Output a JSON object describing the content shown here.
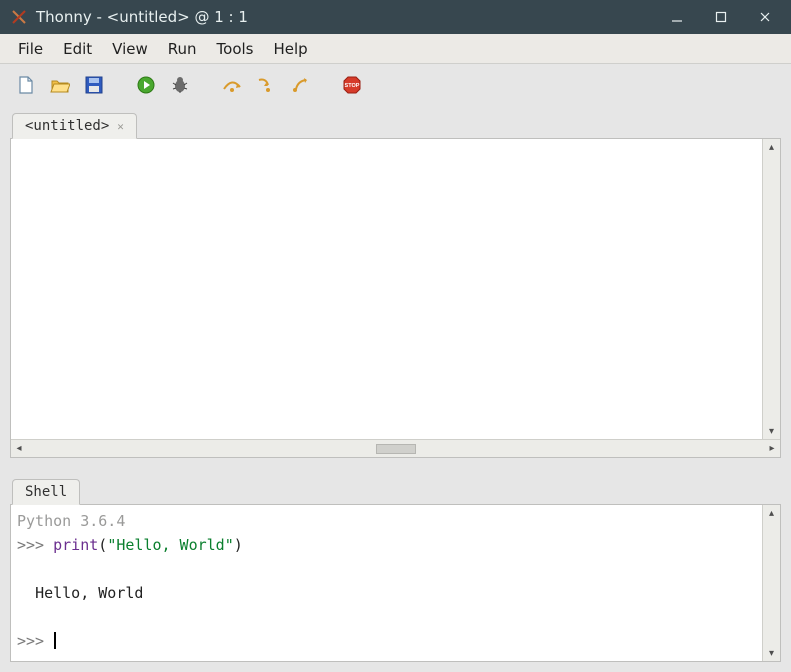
{
  "titlebar": {
    "title": "Thonny  -  <untitled>  @  1 : 1"
  },
  "menu": {
    "items": [
      "File",
      "Edit",
      "View",
      "Run",
      "Tools",
      "Help"
    ]
  },
  "toolbar": {
    "buttons": [
      {
        "name": "new-file-icon"
      },
      {
        "name": "open-file-icon"
      },
      {
        "name": "save-file-icon"
      },
      {
        "sep": true
      },
      {
        "name": "run-icon"
      },
      {
        "name": "debug-icon"
      },
      {
        "sep": true
      },
      {
        "name": "step-over-icon"
      },
      {
        "name": "step-into-icon"
      },
      {
        "name": "step-out-icon"
      },
      {
        "sep": true
      },
      {
        "name": "stop-icon"
      }
    ]
  },
  "editor": {
    "tab_label": "<untitled>"
  },
  "shell": {
    "tab_label": "Shell",
    "banner": "Python 3.6.4",
    "prompt": ">>> ",
    "input_func": "print",
    "input_string": "\"Hello, World\"",
    "output_indent": "  ",
    "output": "Hello, World"
  }
}
